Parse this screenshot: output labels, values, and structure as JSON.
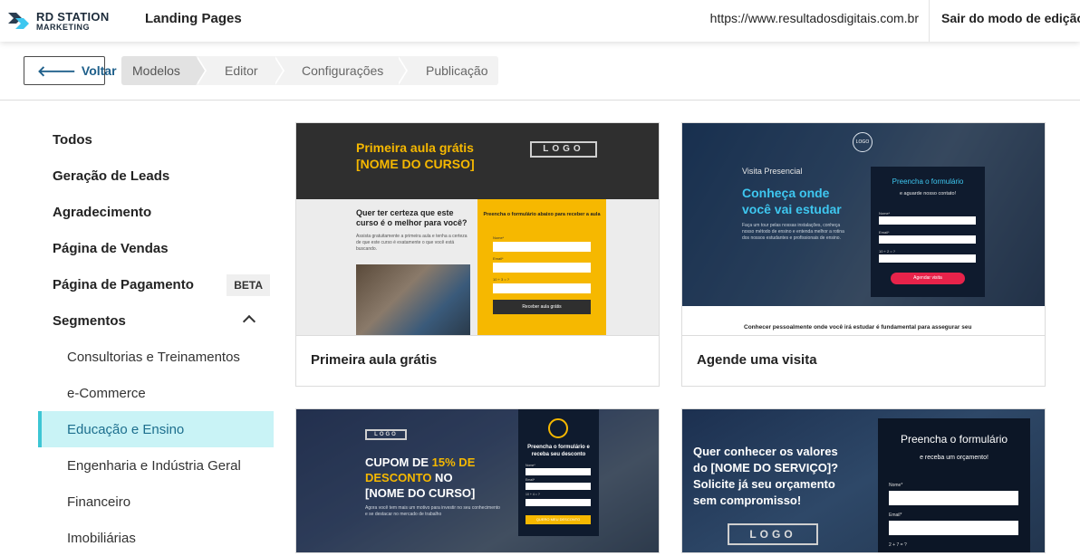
{
  "brand": {
    "line1": "RD STATION",
    "line2": "MARKETING"
  },
  "header": {
    "app_title": "Landing Pages",
    "url": "https://www.resultadosdigitais.com.br",
    "exit_label": "Sair do modo de edição"
  },
  "stepbar": {
    "back_label": "Voltar",
    "steps": [
      "Modelos",
      "Editor",
      "Configurações",
      "Publicação"
    ]
  },
  "sidebar": {
    "items": [
      {
        "label": "Todos"
      },
      {
        "label": "Geração de Leads"
      },
      {
        "label": "Agradecimento"
      },
      {
        "label": "Página de Vendas"
      },
      {
        "label": "Página de Pagamento",
        "badge": "BETA"
      },
      {
        "label": "Segmentos"
      }
    ],
    "segments": [
      "Consultorias e Treinamentos",
      "e-Commerce",
      "Educação e Ensino",
      "Engenharia e Indústria Geral",
      "Financeiro",
      "Imobiliárias"
    ]
  },
  "templates": [
    {
      "caption": "Primeira aula grátis",
      "preview": {
        "headline1": "Primeira aula grátis",
        "headline2": "[NOME DO CURSO]",
        "logo": "LOGO",
        "question": "Quer ter certeza que este curso é o melhor para você?",
        "text": "Assista gratuitamente a primeira aula e tenha a certeza de que este curso é exatamente o que você está buscando.",
        "form_title": "Preencha o formulário abaixo para receber a aula",
        "field1": "Nome*",
        "field2": "Email*",
        "field3": "10 + 3 = ?",
        "button": "Receber aula grátis"
      }
    },
    {
      "caption": "Agende uma visita",
      "preview": {
        "logo": "LOGO",
        "small": "Visita Presencial",
        "headline1": "Conheça onde",
        "headline2": "você vai estudar",
        "text": "Faça um tour pelas nossas instalações, conheça nosso método de ensino e entenda melhor a rotina dos nossos estudantes e profissionais de ensino.",
        "form_title": "Preencha o formulário",
        "form_sub": "e aguarde nosso contato!",
        "field1": "Nome*",
        "field2": "Email*",
        "field3": "10 + 2 = ?",
        "button": "Agendar visita",
        "footer": "Conhecer pessoalmente onde você irá estudar é fundamental para assegurar seu"
      }
    },
    {
      "caption": "",
      "preview": {
        "logo": "LOGO",
        "headline_a": "CUPOM DE ",
        "headline_b": "15% DE",
        "headline_c": "DESCONTO",
        "headline_d": " NO",
        "headline_e": "[NOME DO CURSO]",
        "text": "Agora você tem mais um motivo para investir no seu conhecimento e se destacar no mercado de trabalho",
        "form_title": "Preencha o formulário e receba seu desconto",
        "field1": "Nome*",
        "field2": "Email*",
        "field3": "10 + 4 = ?",
        "button": "QUERO MEU DESCONTO"
      }
    },
    {
      "caption": "",
      "preview": {
        "headline1": "Quer conhecer os valores",
        "headline2": "do [NOME DO SERVIÇO]?",
        "headline3": "Solicite já seu orçamento",
        "headline4": "sem compromisso!",
        "logo": "LOGO",
        "form_title": "Preencha o formulário",
        "form_sub": "e receba um orçamento!",
        "field1": "Nome*",
        "field2": "Email*",
        "field3": "2 + 7 = ?"
      }
    }
  ],
  "colors": {
    "accent_yellow": "#f6b800",
    "selected_bg": "#c9f3f6",
    "selected_border": "#3dc6d4",
    "link_blue": "#1e5f8a"
  }
}
